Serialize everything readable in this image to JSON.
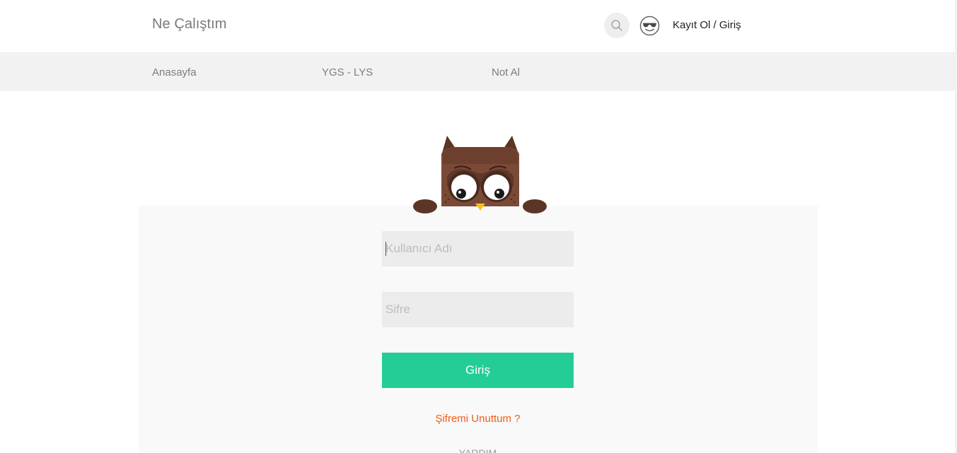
{
  "header": {
    "brand": "Ne Çalıştım",
    "search_icon": "search-icon",
    "avatar_icon": "sunglasses-smiley-icon",
    "auth_link": "Kayıt Ol / Giriş"
  },
  "nav": {
    "items": [
      {
        "label": "Anasayfa"
      },
      {
        "label": "YGS - LYS"
      },
      {
        "label": "Not Al"
      }
    ]
  },
  "login": {
    "mascot_icon": "owl-mascot-icon",
    "username_placeholder": "Kullanıcı Adı",
    "username_value": "",
    "password_placeholder": "Sifre",
    "password_value": "",
    "submit_label": "Giriş",
    "forgot_link": "Şifremi Unuttum ?",
    "cut_off_text": "YARDIM"
  },
  "colors": {
    "accent_green": "#24cd98",
    "link_orange": "#f25c14",
    "nav_bg": "#f2f2f2",
    "panel_bg": "#f9f9f9",
    "owl_brown": "#7b4a36"
  }
}
